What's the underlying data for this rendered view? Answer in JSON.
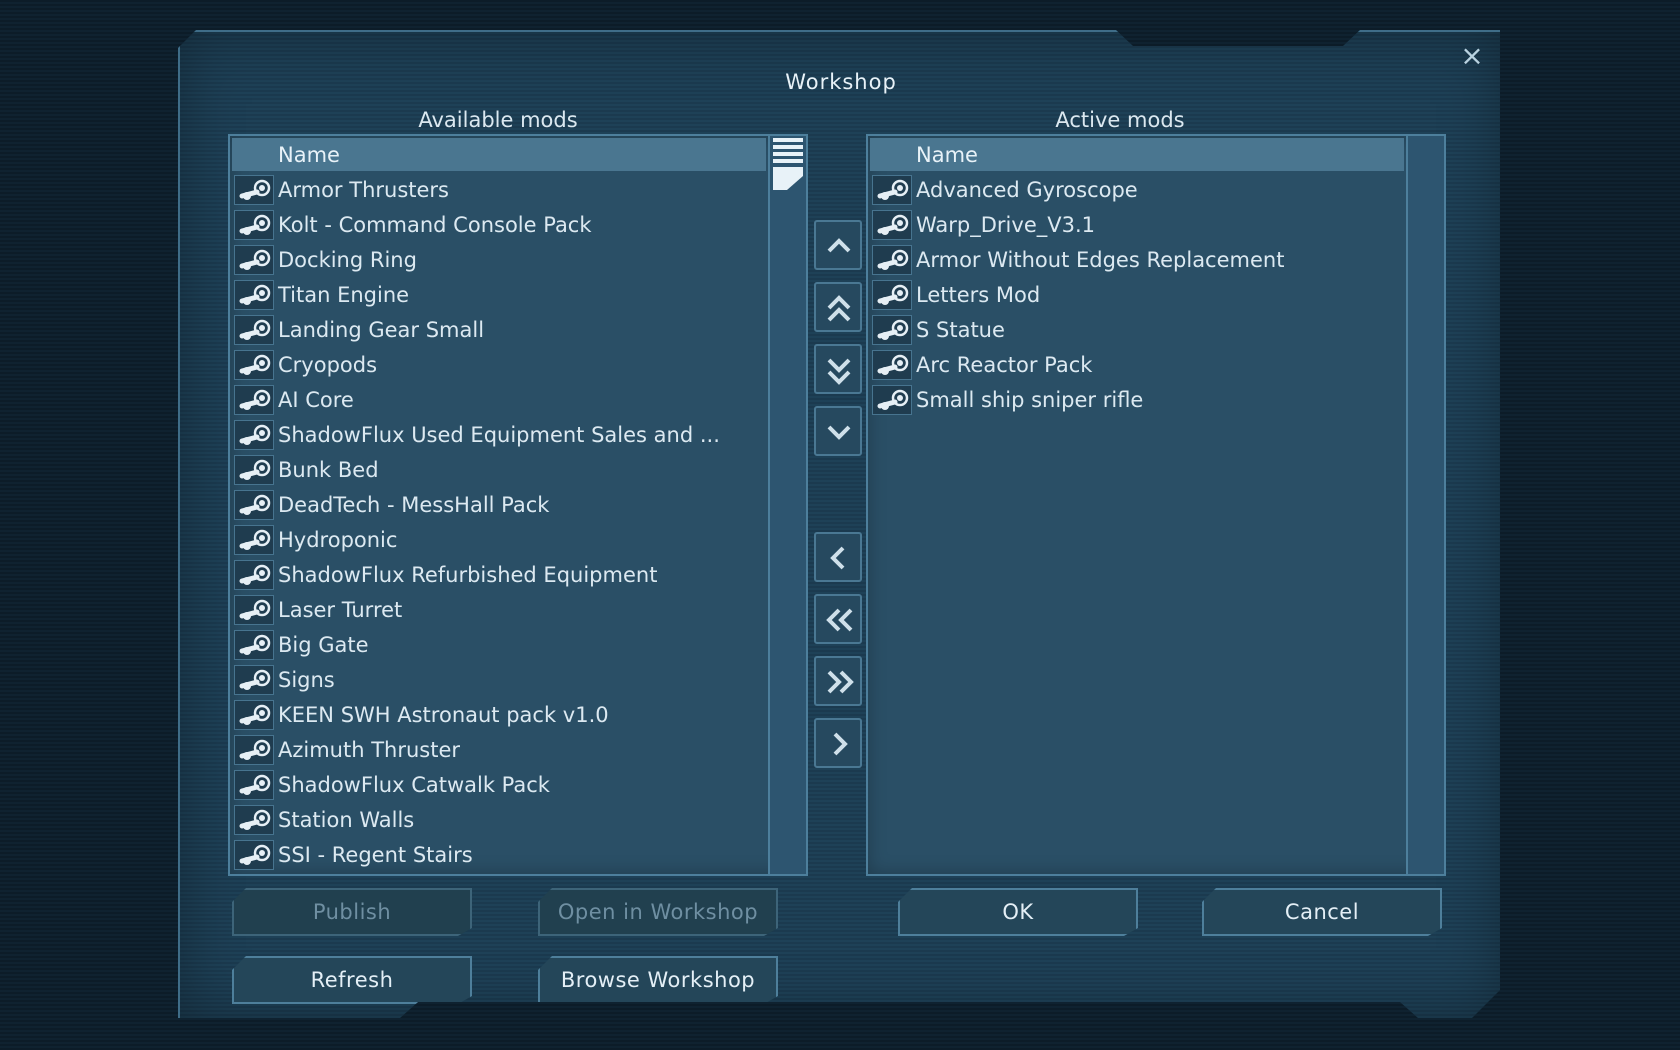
{
  "window": {
    "title": "Workshop",
    "close_icon": "×"
  },
  "available": {
    "label": "Available mods",
    "column_header": "Name",
    "items": [
      "Armor Thrusters",
      "Kolt - Command Console Pack",
      "Docking Ring",
      "Titan Engine",
      "Landing Gear Small",
      "Cryopods",
      "AI Core",
      "ShadowFlux Used Equipment Sales and ...",
      "Bunk Bed",
      "DeadTech - MessHall Pack",
      "Hydroponic",
      "ShadowFlux Refurbished Equipment",
      "Laser Turret",
      "Big Gate",
      "Signs",
      "KEEN SWH Astronaut pack v1.0",
      "Azimuth Thruster",
      "ShadowFlux Catwalk Pack",
      "Station Walls",
      "SSI - Regent Stairs"
    ]
  },
  "active": {
    "label": "Active mods",
    "column_header": "Name",
    "items": [
      "Advanced Gyroscope",
      "Warp_Drive_V3.1",
      "Armor Without Edges Replacement",
      "Letters Mod",
      "S Statue",
      "Arc Reactor Pack",
      "Small ship sniper rifle"
    ]
  },
  "move_buttons": [
    "move-up-icon",
    "move-top-icon",
    "move-bottom-icon",
    "move-down-icon",
    "remove-icon",
    "remove-all-icon",
    "add-all-icon",
    "add-icon"
  ],
  "buttons": {
    "publish": "Publish",
    "open_in_workshop": "Open in Workshop",
    "ok": "OK",
    "cancel": "Cancel",
    "refresh": "Refresh",
    "browse_workshop": "Browse Workshop"
  },
  "colors": {
    "accent": "#4e7f9b",
    "panel": "#2a4f66",
    "background": "#0c1c28"
  }
}
